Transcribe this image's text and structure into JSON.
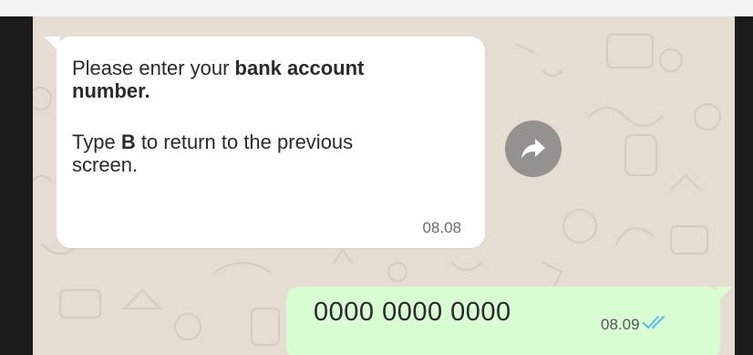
{
  "incoming_message": {
    "line1_plain": "Please enter your ",
    "line1_bold": "bank account",
    "line2_bold": "number.",
    "line3_plain_a": "Type ",
    "line3_bold": "B",
    "line3_plain_b": " to return to the previous",
    "line4_plain": "screen.",
    "time": "08.08"
  },
  "outgoing_message": {
    "text": "0000 0000 0000",
    "time": "08.09",
    "status_icon": "double-check-read-icon"
  },
  "forward_button": {
    "icon": "forward-arrow-icon"
  },
  "colors": {
    "chat_background": "#e6ddd2",
    "incoming_bubble": "#ffffff",
    "outgoing_bubble": "#d9fdd3",
    "read_ticks": "#53bdeb"
  }
}
